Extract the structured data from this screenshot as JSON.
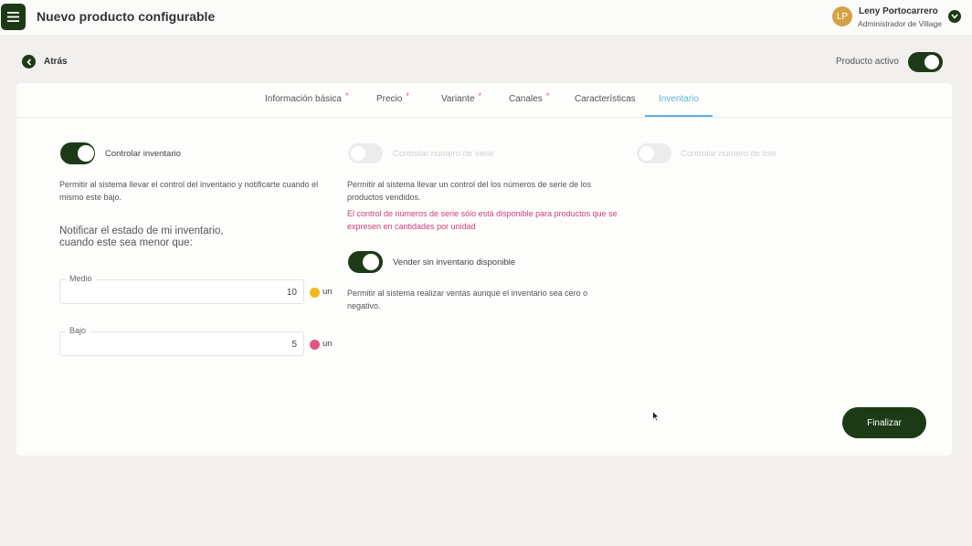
{
  "header": {
    "title": "Nuevo producto configurable",
    "user": {
      "initials": "LP",
      "name": "Leny Portocarrero",
      "role": "Administrador de Village"
    }
  },
  "subheader": {
    "back_label": "Atrás",
    "active_label": "Producto activo",
    "active_on": true
  },
  "tabs": [
    {
      "label": "Información básica",
      "required": "*",
      "active": false
    },
    {
      "label": "Precio",
      "required": "*",
      "active": false
    },
    {
      "label": "Variante",
      "required": "*",
      "active": false
    },
    {
      "label": "Canales",
      "required": "*",
      "active": false
    },
    {
      "label": "Características",
      "required": "",
      "active": false
    },
    {
      "label": "Inventario",
      "required": "",
      "active": true
    }
  ],
  "inventory": {
    "control": {
      "label": "Controlar inventario",
      "on": true,
      "description": "Permitir al sistema llevar el control del inventario y notificarte cuando el mismo este bajo."
    },
    "notify_text": "Notificar el estado de mi inventario, cuando este sea menor que:",
    "medium": {
      "label": "Medio",
      "value": "10",
      "unit": "un",
      "color": "#f2b81c"
    },
    "low": {
      "label": "Bajo",
      "value": "5",
      "unit": "un",
      "color": "#e0568a"
    }
  },
  "serial": {
    "label": "Controlar número de serie",
    "on": false,
    "description": "Permitir al sistema llevar un control del los números de serie de los productos vendidos.",
    "warning": "El control de números de serie sólo está disponible para productos que se expresen en cantidades por unidad"
  },
  "sell_without_stock": {
    "label": "Vender sin inventario disponible",
    "on": true,
    "description": "Permitir al sistema realizar ventas aunque el inventario sea cero o negativo."
  },
  "lot": {
    "label": "Controlar número de lote",
    "on": false
  },
  "actions": {
    "finalize_label": "Finalizar"
  },
  "colors": {
    "brand": "#1d3a16",
    "accent": "#5fb3dd",
    "warning": "#c9417d",
    "avatar": "#d4a246"
  }
}
